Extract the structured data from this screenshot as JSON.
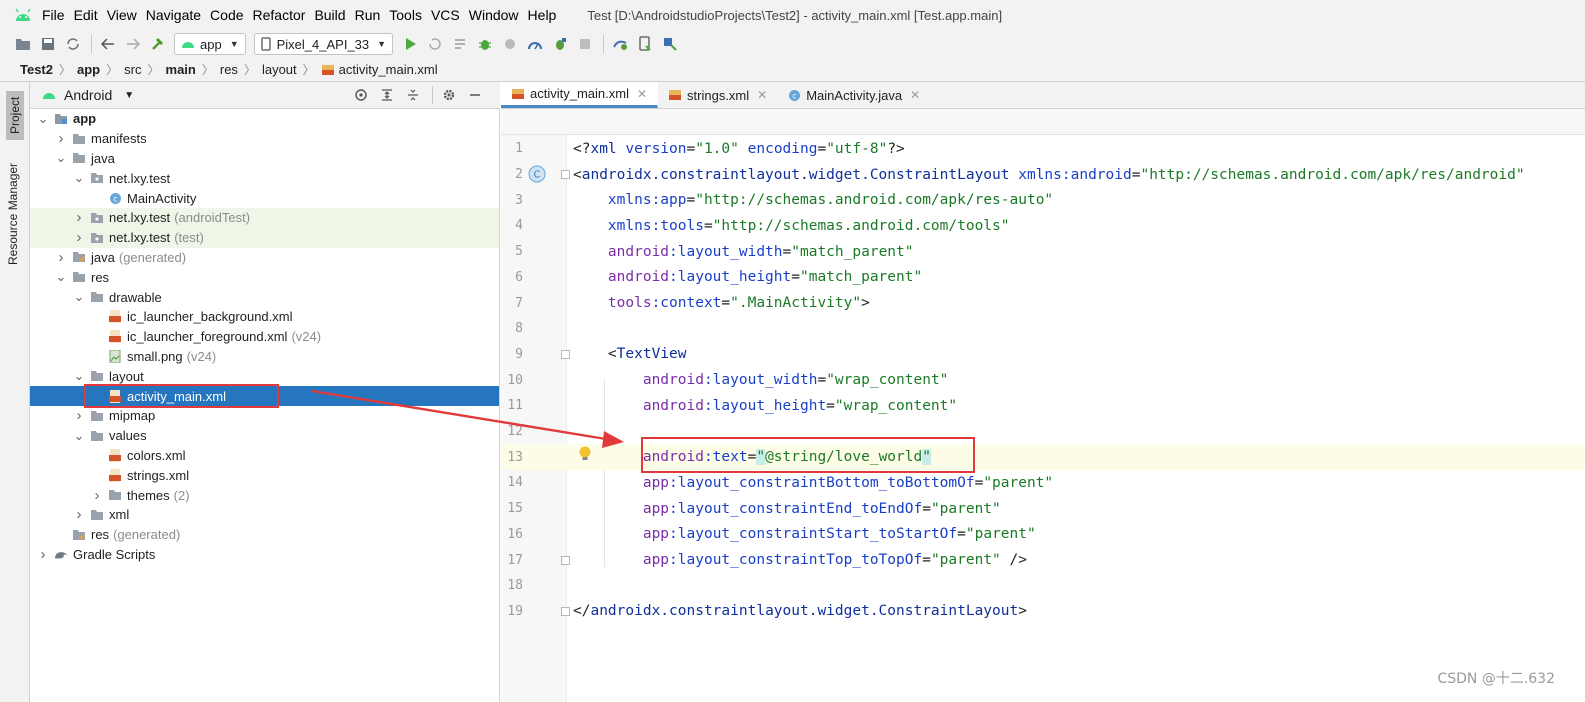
{
  "menubar": {
    "items": [
      "File",
      "Edit",
      "View",
      "Navigate",
      "Code",
      "Refactor",
      "Build",
      "Run",
      "Tools",
      "VCS",
      "Window",
      "Help"
    ],
    "window_title": "Test [D:\\AndroidstudioProjects\\Test2] - activity_main.xml [Test.app.main]"
  },
  "toolbar": {
    "module_combo": "app",
    "device_combo": "Pixel_4_API_33",
    "icons": [
      "open-icon",
      "save-icon",
      "sync-icon",
      "back-icon",
      "forward-icon",
      "build-hammer-icon",
      "run-icon",
      "rerun-icon",
      "coverage-icon",
      "debug-icon",
      "profile-icon",
      "profiler-icon",
      "attach-debugger-icon",
      "stop-icon",
      "gradle-sync-icon",
      "device-manager-icon",
      "sdk-manager-icon"
    ]
  },
  "breadcrumb": [
    "Test2",
    "app",
    "src",
    "main",
    "res",
    "layout",
    "activity_main.xml"
  ],
  "sidestrip": {
    "project_tab": "Project",
    "resource_tab": "Resource Manager"
  },
  "project_panel": {
    "view_mode": "Android",
    "tree": [
      {
        "label": "app",
        "hint": "",
        "depth": 0,
        "expanded": true,
        "icon": "module-icon",
        "bold": true
      },
      {
        "label": "manifests",
        "hint": "",
        "depth": 1,
        "expanded": false,
        "icon": "folder-icon"
      },
      {
        "label": "java",
        "hint": "",
        "depth": 1,
        "expanded": true,
        "icon": "folder-icon"
      },
      {
        "label": "net.lxy.test",
        "hint": "",
        "depth": 2,
        "expanded": true,
        "icon": "package-icon"
      },
      {
        "label": "MainActivity",
        "hint": "",
        "depth": 3,
        "expanded": null,
        "icon": "class-icon"
      },
      {
        "label": "net.lxy.test",
        "hint": "(androidTest)",
        "depth": 2,
        "expanded": false,
        "icon": "package-icon",
        "green": true
      },
      {
        "label": "net.lxy.test",
        "hint": "(test)",
        "depth": 2,
        "expanded": false,
        "icon": "package-icon",
        "green": true
      },
      {
        "label": "java",
        "hint": "(generated)",
        "depth": 1,
        "expanded": false,
        "icon": "generated-folder-icon"
      },
      {
        "label": "res",
        "hint": "",
        "depth": 1,
        "expanded": true,
        "icon": "folder-icon"
      },
      {
        "label": "drawable",
        "hint": "",
        "depth": 2,
        "expanded": true,
        "icon": "folder-icon"
      },
      {
        "label": "ic_launcher_background.xml",
        "hint": "",
        "depth": 3,
        "expanded": null,
        "icon": "xml-file-icon"
      },
      {
        "label": "ic_launcher_foreground.xml",
        "hint": "(v24)",
        "depth": 3,
        "expanded": null,
        "icon": "xml-file-icon"
      },
      {
        "label": "small.png",
        "hint": "(v24)",
        "depth": 3,
        "expanded": null,
        "icon": "image-file-icon"
      },
      {
        "label": "layout",
        "hint": "",
        "depth": 2,
        "expanded": true,
        "icon": "folder-icon"
      },
      {
        "label": "activity_main.xml",
        "hint": "",
        "depth": 3,
        "expanded": null,
        "icon": "xml-file-icon",
        "selected": true
      },
      {
        "label": "mipmap",
        "hint": "",
        "depth": 2,
        "expanded": false,
        "icon": "folder-icon"
      },
      {
        "label": "values",
        "hint": "",
        "depth": 2,
        "expanded": true,
        "icon": "folder-icon"
      },
      {
        "label": "colors.xml",
        "hint": "",
        "depth": 3,
        "expanded": null,
        "icon": "xml-file-icon"
      },
      {
        "label": "strings.xml",
        "hint": "",
        "depth": 3,
        "expanded": null,
        "icon": "xml-file-icon"
      },
      {
        "label": "themes",
        "hint": "(2)",
        "depth": 3,
        "expanded": false,
        "icon": "folder-icon"
      },
      {
        "label": "xml",
        "hint": "",
        "depth": 2,
        "expanded": false,
        "icon": "folder-icon"
      },
      {
        "label": "res",
        "hint": "(generated)",
        "depth": 1,
        "expanded": null,
        "icon": "generated-folder-icon"
      },
      {
        "label": "Gradle Scripts",
        "hint": "",
        "depth": 0,
        "expanded": false,
        "icon": "gradle-icon"
      }
    ]
  },
  "editor": {
    "tabs": [
      {
        "label": "activity_main.xml",
        "icon": "xml-file-icon",
        "active": true
      },
      {
        "label": "strings.xml",
        "icon": "xml-file-icon",
        "active": false
      },
      {
        "label": "MainActivity.java",
        "icon": "class-icon",
        "active": false
      }
    ],
    "line_numbers": [
      "1",
      "2",
      "3",
      "4",
      "5",
      "6",
      "7",
      "8",
      "9",
      "10",
      "11",
      "12",
      "13",
      "14",
      "15",
      "16",
      "17",
      "18",
      "19"
    ],
    "current_line": 13,
    "lines": [
      [
        [
          "t-punc",
          "<?"
        ],
        [
          "t-tag",
          "xml "
        ],
        [
          "t-attr",
          "version"
        ],
        [
          "t-punc",
          "="
        ],
        [
          "t-val",
          "\"1.0\" "
        ],
        [
          "t-attr",
          "encoding"
        ],
        [
          "t-punc",
          "="
        ],
        [
          "t-val",
          "\"utf-8\""
        ],
        [
          "t-punc",
          "?>"
        ]
      ],
      [
        [
          "t-punc",
          "<"
        ],
        [
          "t-tag",
          "androidx.constraintlayout.widget.ConstraintLayout "
        ],
        [
          "t-attr",
          "xmlns:android"
        ],
        [
          "t-punc",
          "="
        ],
        [
          "t-val",
          "\"http://schemas.android.com/apk/res/android\""
        ]
      ],
      [
        [
          "t-punc",
          "    "
        ],
        [
          "t-attr",
          "xmlns:app"
        ],
        [
          "t-punc",
          "="
        ],
        [
          "t-val",
          "\"http://schemas.android.com/apk/res-auto\""
        ]
      ],
      [
        [
          "t-punc",
          "    "
        ],
        [
          "t-attr",
          "xmlns:tools"
        ],
        [
          "t-punc",
          "="
        ],
        [
          "t-val",
          "\"http://schemas.android.com/tools\""
        ]
      ],
      [
        [
          "t-punc",
          "    "
        ],
        [
          "t-ns",
          "android"
        ],
        [
          "t-attr",
          ":layout_width"
        ],
        [
          "t-punc",
          "="
        ],
        [
          "t-val",
          "\"match_parent\""
        ]
      ],
      [
        [
          "t-punc",
          "    "
        ],
        [
          "t-ns",
          "android"
        ],
        [
          "t-attr",
          ":layout_height"
        ],
        [
          "t-punc",
          "="
        ],
        [
          "t-val",
          "\"match_parent\""
        ]
      ],
      [
        [
          "t-punc",
          "    "
        ],
        [
          "t-ns",
          "tools"
        ],
        [
          "t-attr",
          ":context"
        ],
        [
          "t-punc",
          "="
        ],
        [
          "t-val",
          "\".MainActivity\""
        ],
        [
          "t-punc",
          ">"
        ]
      ],
      [],
      [
        [
          "t-punc",
          "    <"
        ],
        [
          "t-tag",
          "TextView"
        ]
      ],
      [
        [
          "t-punc",
          "        "
        ],
        [
          "t-ns",
          "android"
        ],
        [
          "t-attr",
          ":layout_width"
        ],
        [
          "t-punc",
          "="
        ],
        [
          "t-val",
          "\"wrap_content\""
        ]
      ],
      [
        [
          "t-punc",
          "        "
        ],
        [
          "t-ns",
          "android"
        ],
        [
          "t-attr",
          ":layout_height"
        ],
        [
          "t-punc",
          "="
        ],
        [
          "t-val",
          "\"wrap_content\""
        ]
      ],
      [],
      [
        [
          "t-punc",
          "        "
        ],
        [
          "t-ns",
          "android"
        ],
        [
          "t-attr",
          ":text"
        ],
        [
          "t-punc",
          "="
        ],
        [
          "t-val t-hl",
          "\""
        ],
        [
          "t-val",
          "@string/love_world"
        ],
        [
          "t-val t-hl",
          "\""
        ]
      ],
      [
        [
          "t-punc",
          "        "
        ],
        [
          "t-ns",
          "app"
        ],
        [
          "t-attr",
          ":layout_constraintBottom_toBottomOf"
        ],
        [
          "t-punc",
          "="
        ],
        [
          "t-val",
          "\"parent\""
        ]
      ],
      [
        [
          "t-punc",
          "        "
        ],
        [
          "t-ns",
          "app"
        ],
        [
          "t-attr",
          ":layout_constraintEnd_toEndOf"
        ],
        [
          "t-punc",
          "="
        ],
        [
          "t-val",
          "\"parent\""
        ]
      ],
      [
        [
          "t-punc",
          "        "
        ],
        [
          "t-ns",
          "app"
        ],
        [
          "t-attr",
          ":layout_constraintStart_toStartOf"
        ],
        [
          "t-punc",
          "="
        ],
        [
          "t-val",
          "\"parent\""
        ]
      ],
      [
        [
          "t-punc",
          "        "
        ],
        [
          "t-ns",
          "app"
        ],
        [
          "t-attr",
          ":layout_constraintTop_toTopOf"
        ],
        [
          "t-punc",
          "="
        ],
        [
          "t-val",
          "\"parent\" "
        ],
        [
          "t-punc",
          "/>"
        ]
      ],
      [],
      [
        [
          "t-punc",
          "</"
        ],
        [
          "t-tag",
          "androidx.constraintlayout.widget.ConstraintLayout"
        ],
        [
          "t-punc",
          ">"
        ]
      ]
    ]
  },
  "watermark": "CSDN @十二.632",
  "colors": {
    "selection": "#2675bf",
    "annotation_red": "#e23a3a",
    "current_line": "#fdfce7"
  }
}
